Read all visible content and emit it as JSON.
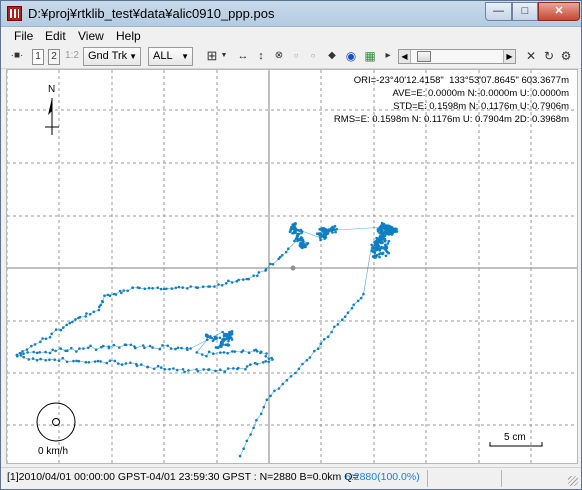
{
  "window": {
    "title": "D:¥proj¥rtklib_test¥data¥alic0910_ppp.pos",
    "min_glyph": "—",
    "max_glyph": "□",
    "close_glyph": "✕"
  },
  "menu": [
    {
      "label": "File",
      "key": "file"
    },
    {
      "label": "Edit",
      "key": "edit"
    },
    {
      "label": "View",
      "key": "view"
    },
    {
      "label": "Help",
      "key": "help"
    }
  ],
  "toolbar": {
    "ruler_glyph": "·■·",
    "sol1_label": "1",
    "sol2_label": "2",
    "sol12_label": "1:2",
    "plot_type": "Gnd Trk",
    "quality_filter": "ALL",
    "icons": {
      "crosshair": "crosshair-icon",
      "fit_horizontal": "fit-horizontal-icon",
      "fit_vertical": "fit-vertical-icon",
      "center": "center-origin-icon",
      "point_a": "small-dot-icon",
      "point_b": "small-dot-icon",
      "fix_center": "diamond-icon",
      "sky": "globe-icon",
      "map": "map-image-icon",
      "clear": "close-icon",
      "reload": "reload-icon",
      "options": "gear-icon"
    }
  },
  "plot": {
    "info_lines": [
      "ORI=-23°40'12.4158\"  133°53'07.8645\" 603.3677m",
      "AVE=E: 0.0000m N:-0.0000m U: 0.0000m",
      "STD=E: 0.1598m N: 0.1176m U: 0.7906m",
      "RMS=E: 0.1598m N: 0.1176m U: 0.7904m 2D: 0.3968m"
    ],
    "north_label": "N",
    "velocity_label": "0 km/h",
    "scale_label": "5 cm",
    "track_color": "#0e7fc2",
    "grid_color": "#9a9a9a"
  },
  "status": {
    "text": "[1]2010/04/01 00:00:00 GPST-04/01 23:59:30 GPST : N=2880 B=0.0km Q=",
    "quality": "6:2880(100.0%)"
  }
}
